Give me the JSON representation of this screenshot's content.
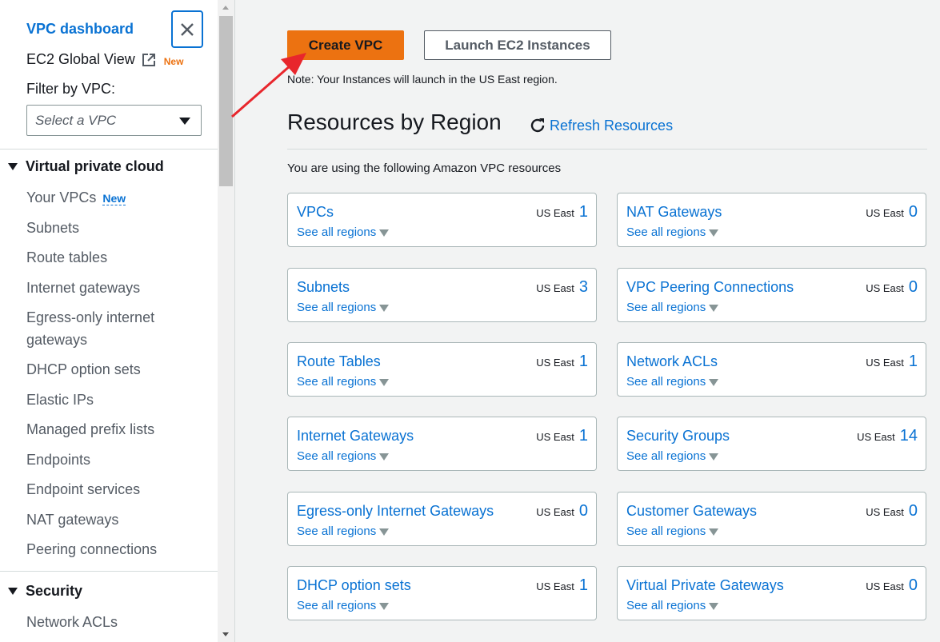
{
  "sidebar": {
    "title": "VPC dashboard",
    "global_view": "EC2 Global View",
    "global_view_badge": "New",
    "filter_label": "Filter by VPC:",
    "filter_placeholder": "Select a VPC",
    "section_vpc": "Virtual private cloud",
    "items": [
      {
        "label": "Your VPCs",
        "badge": "New"
      },
      {
        "label": "Subnets"
      },
      {
        "label": "Route tables"
      },
      {
        "label": "Internet gateways"
      },
      {
        "label": "Egress-only internet gateways"
      },
      {
        "label": "DHCP option sets"
      },
      {
        "label": "Elastic IPs"
      },
      {
        "label": "Managed prefix lists"
      },
      {
        "label": "Endpoints"
      },
      {
        "label": "Endpoint services"
      },
      {
        "label": "NAT gateways"
      },
      {
        "label": "Peering connections"
      }
    ],
    "section_security": "Security",
    "security_items": [
      {
        "label": "Network ACLs"
      }
    ]
  },
  "main": {
    "create_vpc": "Create VPC",
    "launch_ec2": "Launch EC2 Instances",
    "note": "Note: Your Instances will launch in the US East region.",
    "title": "Resources by Region",
    "refresh": "Refresh Resources",
    "using_text": "You are using the following Amazon VPC resources",
    "see_all": "See all regions",
    "region_label": "US East",
    "cards": [
      {
        "name": "VPCs",
        "count": "1"
      },
      {
        "name": "NAT Gateways",
        "count": "0"
      },
      {
        "name": "Subnets",
        "count": "3"
      },
      {
        "name": "VPC Peering Connections",
        "count": "0"
      },
      {
        "name": "Route Tables",
        "count": "1"
      },
      {
        "name": "Network ACLs",
        "count": "1"
      },
      {
        "name": "Internet Gateways",
        "count": "1"
      },
      {
        "name": "Security Groups",
        "count": "14"
      },
      {
        "name": "Egress-only Internet Gateways",
        "count": "0"
      },
      {
        "name": "Customer Gateways",
        "count": "0"
      },
      {
        "name": "DHCP option sets",
        "count": "1"
      },
      {
        "name": "Virtual Private Gateways",
        "count": "0"
      }
    ]
  },
  "colors": {
    "accent": "#0972d3",
    "primary_button": "#ec7211",
    "annotation_arrow": "#e8262c"
  }
}
